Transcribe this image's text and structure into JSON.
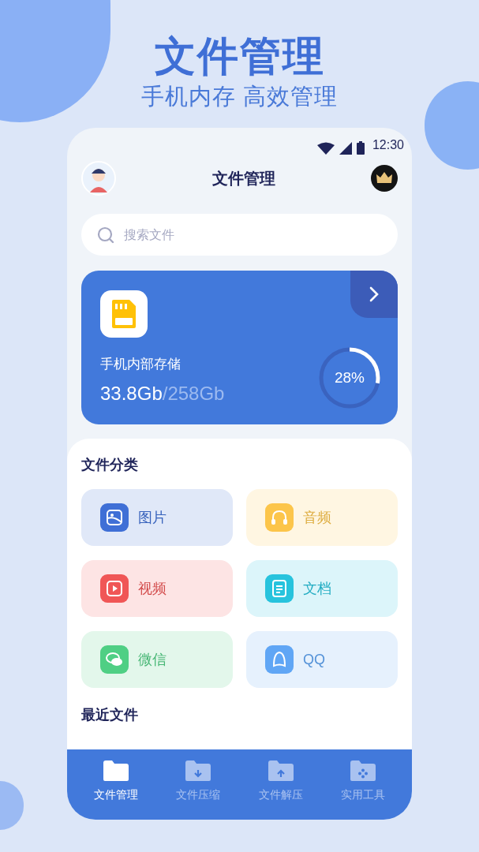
{
  "headline": {
    "title": "文件管理",
    "subtitle": "手机内存 高效管理"
  },
  "status_bar": {
    "time": "12:30"
  },
  "header": {
    "title": "文件管理"
  },
  "search": {
    "placeholder": "搜索文件"
  },
  "storage": {
    "name": "手机内部存储",
    "used": "33.8Gb",
    "total": "/258Gb",
    "percent": "28%"
  },
  "categories": {
    "title": "文件分类",
    "items": [
      {
        "label": "图片",
        "kind": "image",
        "color": "#3f6fd6"
      },
      {
        "label": "音频",
        "kind": "audio",
        "color": "#fcc54a"
      },
      {
        "label": "视频",
        "kind": "video",
        "color": "#f05656"
      },
      {
        "label": "文档",
        "kind": "document",
        "color": "#27c3dd"
      },
      {
        "label": "微信",
        "kind": "chat",
        "color": "#4fcf84"
      },
      {
        "label": "QQ",
        "kind": "penguin",
        "color": "#60a6f5"
      }
    ]
  },
  "recent": {
    "title": "最近文件"
  },
  "nav": [
    {
      "label": "文件管理",
      "kind": "folder",
      "selected": true
    },
    {
      "label": "文件压缩",
      "kind": "compress",
      "selected": false
    },
    {
      "label": "文件解压",
      "kind": "extract",
      "selected": false
    },
    {
      "label": "实用工具",
      "kind": "tools",
      "selected": false
    }
  ]
}
